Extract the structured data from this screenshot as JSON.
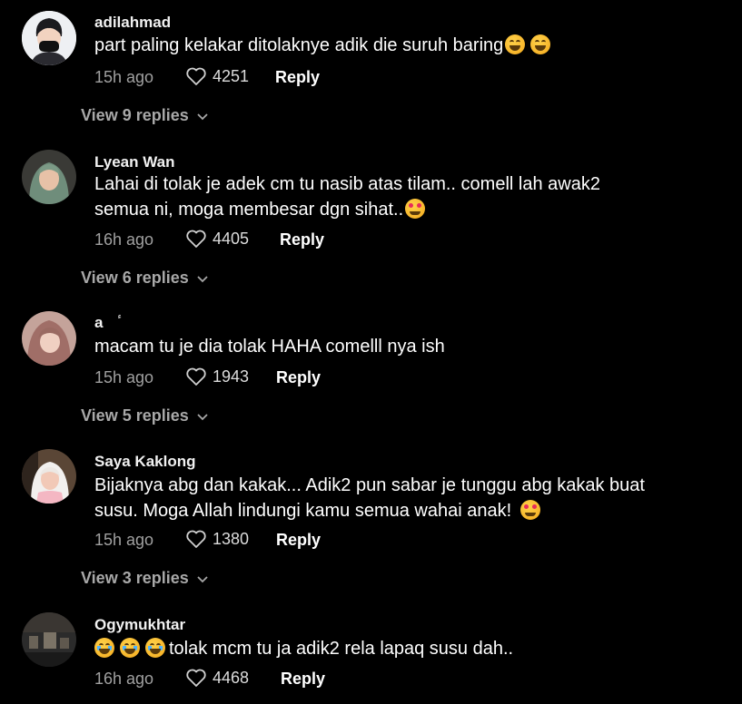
{
  "comments": [
    {
      "username": "adilahmad",
      "text": "part paling kelakar ditolaknye adik die suruh baring",
      "time": "15h ago",
      "likes": "4251",
      "reply_label": "Reply",
      "view_replies": "View 9 replies"
    },
    {
      "username": "Lyean Wan",
      "text_line1": "Lahai di tolak je adek cm tu nasib atas tilam.. comell lah awak2",
      "text_line2": "semua ni, moga membesar dgn sihat..",
      "time": "16h ago",
      "likes": "4405",
      "reply_label": "Reply",
      "view_replies": "View 6 replies"
    },
    {
      "username": "a",
      "username_symbol": "ٔ",
      "text": "macam tu je dia tolak HAHA comelll nya ish",
      "time": "15h ago",
      "likes": "1943",
      "reply_label": "Reply",
      "view_replies": "View 5 replies"
    },
    {
      "username": "Saya Kaklong",
      "text_line1": "Bijaknya abg dan kakak... Adik2 pun sabar je tunggu abg kakak buat",
      "text_line2": "susu. Moga Allah lindungi kamu semua wahai anak!",
      "time": "15h ago",
      "likes": "1380",
      "reply_label": "Reply",
      "view_replies": "View 3 replies"
    },
    {
      "username": "Ogymukhtar",
      "text": "tolak mcm tu ja adik2 rela lapaq susu dah..",
      "time": "16h ago",
      "likes": "4468",
      "reply_label": "Reply"
    }
  ],
  "icons": {
    "like": "heart-outline-icon",
    "expand": "chevron-down-icon",
    "emoji_grin": "grinning-sweat-emoji",
    "emoji_love": "smiling-hearts-emoji",
    "emoji_laugh": "tears-of-joy-emoji"
  },
  "colors": {
    "background": "#000000",
    "text": "#ffffff",
    "muted": "#a0a0a0"
  }
}
